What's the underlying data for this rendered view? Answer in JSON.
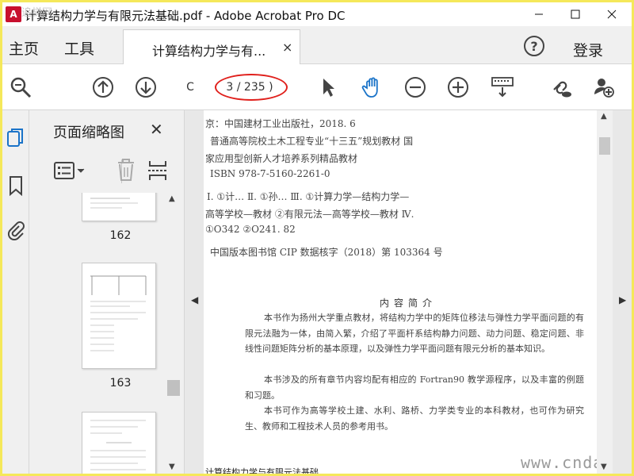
{
  "window": {
    "title": "计算结构力学与有限元法基础.pdf - Adobe Acrobat Pro DC",
    "watermark_top": "追梯网"
  },
  "menubar": {
    "home": "主页",
    "tools": "工具",
    "tab_label": "计算结构力学与有...",
    "tab_close": "×",
    "help": "?",
    "login": "登录"
  },
  "toolbar": {
    "page_current": "C",
    "page_total": "3 / 235 )"
  },
  "thumbnails": {
    "title": "页面缩略图",
    "close": "✕",
    "pages": [
      {
        "label": "162"
      },
      {
        "label": "163"
      }
    ]
  },
  "document": {
    "cip_lines": [
      "京：中国建材工业出版社，2018. 6",
      "普通高等院校土木工程专业“十三五”规划教材   国",
      "家应用型创新人才培养系列精品教材",
      "ISBN 978-7-5160-2261-0",
      "Ⅰ. ①计…   Ⅱ. ①孙…   Ⅲ. ①计算力学—结构力学—",
      "高等学校—教材   ②有限元法—高等学校—教材   Ⅳ.",
      "①O342   ②O241. 82",
      "中国版本图书馆 CIP 数据核字（2018）第 103364 号"
    ],
    "section_title": "内容简介",
    "paragraphs": [
      "本书作为扬州大学重点教材，将结构力学中的矩阵位移法与弹性力学平面问题的有限元法融为一体，由简入繁，介绍了平面杆系结构静力问题、动力问题、稳定问题、非线性问题矩阵分析的基本原理，以及弹性力学平面问题有限元分析的基本知识。",
      "本书涉及的所有章节内容均配有相应的 Fortran90 教学源程序，以及丰富的例题和习题。",
      "本书可作为高等学校土建、水利、路桥、力学类专业的本科教材，也可作为研究生、教师和工程技术人员的参考用书。"
    ],
    "footer": "计算结构力学与有限元法基础",
    "watermark": "www.cndao.com"
  },
  "colors": {
    "accent_blue": "#1a73c8",
    "annotation_red": "#e0201c",
    "acrobat_red": "#c8102e",
    "frame_yellow": "#f5e85a"
  },
  "icons": [
    "acrobat-icon",
    "minimize-icon",
    "maximize-icon",
    "close-icon",
    "zoom-icon",
    "arrow-up-circle-icon",
    "arrow-down-circle-icon",
    "select-arrow-icon",
    "hand-tool-icon",
    "zoom-out-icon",
    "zoom-in-icon",
    "keyboard-icon",
    "link-cloud-icon",
    "add-user-icon",
    "pages-icon",
    "bookmark-icon",
    "paperclip-icon",
    "options-list-icon",
    "trash-icon",
    "crop-icon"
  ]
}
